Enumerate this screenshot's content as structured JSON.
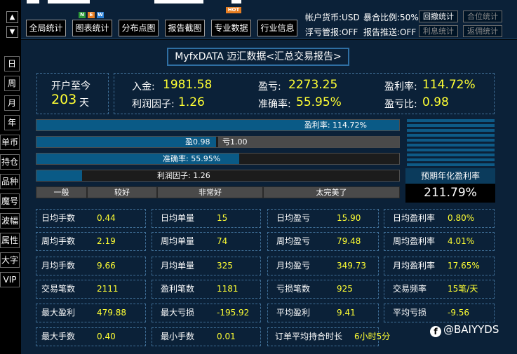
{
  "nav": {
    "up_arrow": "▲",
    "down_arrow": "▼",
    "left_tabs": [
      "日",
      "周",
      "月",
      "年",
      "单币",
      "持仓",
      "品种",
      "魔号",
      "波幅",
      "属性",
      "大字",
      "VIP"
    ]
  },
  "toolbar": {
    "buttons": [
      "全局统计",
      "图表统计",
      "分布点图",
      "报告截图",
      "专业数据",
      "行业信息"
    ],
    "badge_new": [
      "N",
      "E",
      "W"
    ],
    "badge_hot": "HOT"
  },
  "status": {
    "currency": "帐户货币:USD",
    "exposure": "暴合比例:50%",
    "float_control": "浮亏管报:OFF",
    "push": "报告推送:OFF",
    "btn_drawdown": "回撤统计",
    "btn_position": "合位统计",
    "btn_interest": "利息统计",
    "btn_rebate": "返佣统计"
  },
  "title": "MyfxDATA 迈汇数据<汇总交易报告>",
  "summary": {
    "since_label": "开户至今",
    "days_value": "203",
    "days_unit": "天",
    "deposit_label": "入金:",
    "deposit_value": "1981.58",
    "pnl_label": "盈亏:",
    "pnl_value": "2273.25",
    "profit_rate_label": "盈利率:",
    "profit_rate_value": "114.72%",
    "profit_factor_label": "利润因子:",
    "profit_factor_value": "1.26",
    "accuracy_label": "准确率:",
    "accuracy_value": "55.95%",
    "pl_ratio_label": "盈亏比:",
    "pl_ratio_value": "0.98"
  },
  "bars": {
    "profit_rate_text": "盈利率:  114.72%",
    "profit_rate_fill": 1.0,
    "win_text": "盈0.98",
    "loss_text": "亏1.00",
    "win_share": 0.495,
    "accuracy_text": "准确率:  55.95%",
    "accuracy_fill": 0.5595,
    "factor_text": "利润因子:  1.26",
    "factor_fill": 0.126
  },
  "scale": [
    "一般",
    "较好",
    "非常好",
    "太完美了"
  ],
  "projection": {
    "label": "预期年化盈利率",
    "value": "211.79%"
  },
  "stats": [
    [
      {
        "l": "日均手数",
        "v": "0.44"
      },
      {
        "l": "日均单量",
        "v": "15"
      },
      {
        "l": "日均盈亏",
        "v": "15.90"
      },
      {
        "l": "日均盈利率",
        "v": "0.80%"
      }
    ],
    [
      {
        "l": "周均手数",
        "v": "2.19"
      },
      {
        "l": "周均单量",
        "v": "74"
      },
      {
        "l": "周均盈亏",
        "v": "79.48"
      },
      {
        "l": "周均盈利率",
        "v": "4.01%"
      }
    ],
    [
      {
        "l": "月均手数",
        "v": "9.66"
      },
      {
        "l": "月均单量",
        "v": "325"
      },
      {
        "l": "月均盈亏",
        "v": "349.73"
      },
      {
        "l": "月均盈利率",
        "v": "17.65%"
      }
    ],
    [
      {
        "l": "交易笔数",
        "v": "2111"
      },
      {
        "l": "盈利笔数",
        "v": "1181"
      },
      {
        "l": "亏损笔数",
        "v": "925"
      },
      {
        "l": "交易频率",
        "v": "15笔/天"
      }
    ],
    [
      {
        "l": "最大盈利",
        "v": "479.88"
      },
      {
        "l": "最大亏损",
        "v": "-195.92"
      },
      {
        "l": "平均盈利",
        "v": "9.41"
      },
      {
        "l": "平均亏损",
        "v": "-9.56"
      }
    ]
  ],
  "last_row": {
    "min_lots_label": "最大手数",
    "min_lots_value": "0.40",
    "min_label": "最小手数",
    "min_value": "0.01",
    "hold_label": "订单平均持合时长",
    "hold_value": "6小时5分"
  },
  "watermark": "@BAIYYDS",
  "colors": {
    "value": "#ffff33",
    "panel": "#0b2138",
    "bar": "#0a5a86"
  }
}
